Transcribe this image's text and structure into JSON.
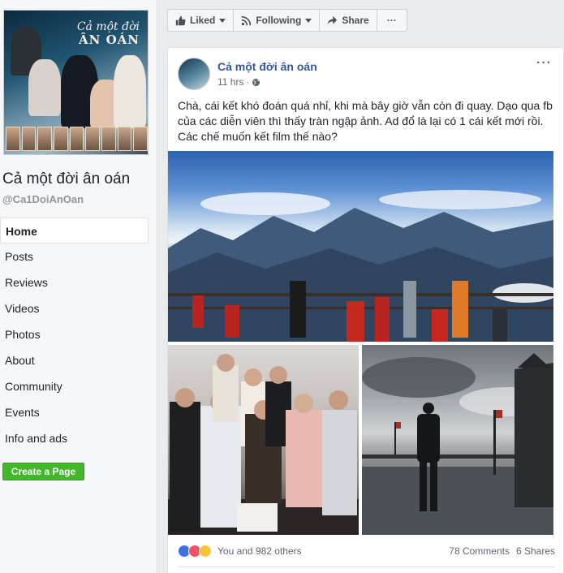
{
  "sidebar": {
    "cover": {
      "title_line1": "Cả một đời",
      "title_line2": "ÂN OÁN"
    },
    "page_name": "Cả một đời ân oán",
    "page_handle": "@Ca1DoiAnOan",
    "nav": [
      {
        "label": "Home",
        "active": true
      },
      {
        "label": "Posts"
      },
      {
        "label": "Reviews"
      },
      {
        "label": "Videos"
      },
      {
        "label": "Photos"
      },
      {
        "label": "About"
      },
      {
        "label": "Community"
      },
      {
        "label": "Events"
      },
      {
        "label": "Info and ads"
      }
    ],
    "create_page_label": "Create a Page"
  },
  "actionbar": {
    "liked_label": "Liked",
    "following_label": "Following",
    "share_label": "Share",
    "more_label": "···"
  },
  "post": {
    "author": "Cả một đời ân oán",
    "time": "11 hrs",
    "menu_label": "···",
    "text": "Chà, cái kết khó đoán quá nhỉ, khi mà bây giờ vẫn còn đi quay. Dạo qua fb của các diễn viên thì thấy tràn ngập ảnh. Ad đổ là lại có 1 cái kết mới rồi. Các chế muốn kết film thế nào?",
    "reactions_text": "You and 982 others",
    "comments_text": "78 Comments",
    "shares_text": "6 Shares"
  },
  "colors": {
    "link_blue": "#365899",
    "create_green": "#42b72a",
    "page_bg": "#e9ebee"
  }
}
